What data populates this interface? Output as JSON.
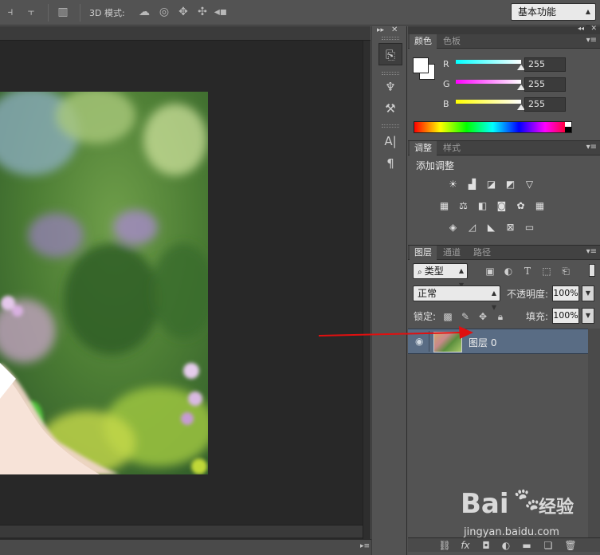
{
  "options_bar": {
    "mode_3d_label": "3D 模式:",
    "workspace": "基本功能"
  },
  "color_panel": {
    "tabs": [
      "颜色",
      "色板"
    ],
    "active_tab": 0,
    "channels": [
      {
        "label": "R",
        "value": "255",
        "fraction": 1.0
      },
      {
        "label": "G",
        "value": "255",
        "fraction": 1.0
      },
      {
        "label": "B",
        "value": "255",
        "fraction": 1.0
      }
    ],
    "foreground": "#ffffff",
    "background": "#ffffff"
  },
  "adjust_panel": {
    "tabs": [
      "调整",
      "样式"
    ],
    "active_tab": 0,
    "heading": "添加调整"
  },
  "layers_panel": {
    "tabs": [
      "图层",
      "通道",
      "路径"
    ],
    "active_tab": 0,
    "filter_kind": "类型",
    "blend_mode": "正常",
    "opacity_label": "不透明度:",
    "opacity_value": "100%",
    "lock_label": "锁定:",
    "fill_label": "填充:",
    "fill_value": "100%",
    "layers": [
      {
        "name": "图层 0",
        "visible": true,
        "selected": true
      }
    ]
  },
  "watermark": {
    "brand": "Bai",
    "brand2": "经验",
    "url": "jingyan.baidu.com"
  },
  "colors": {
    "selection": "#596c84",
    "annotation_arrow": "#e01010"
  }
}
